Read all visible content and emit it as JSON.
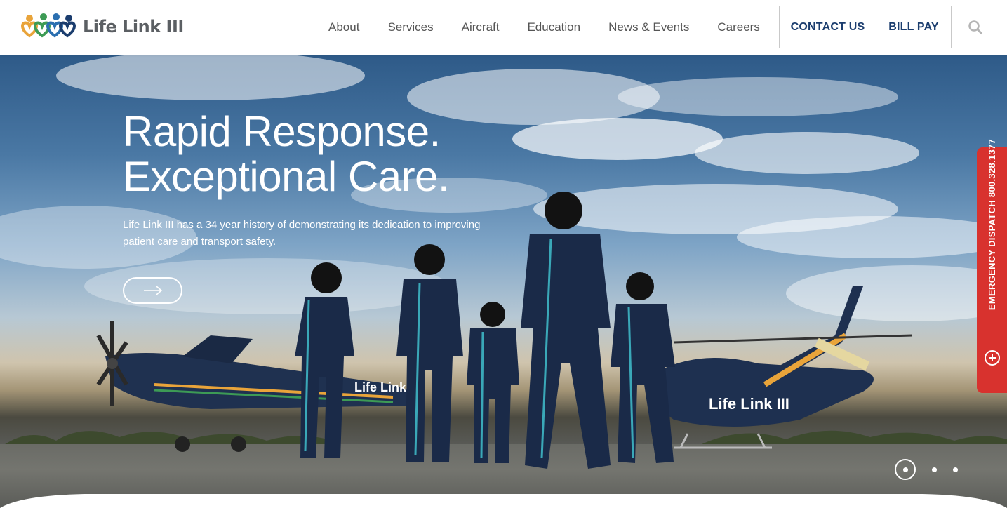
{
  "brand": {
    "name": "Life Link III",
    "colors": {
      "navy": "#1b3d6e",
      "orange": "#e9a43a",
      "green": "#3d9b55",
      "blue": "#2b6fb0",
      "red": "#d8322e"
    }
  },
  "nav": {
    "items": [
      "About",
      "Services",
      "Aircraft",
      "Education",
      "News & Events",
      "Careers"
    ],
    "contact_label": "CONTACT US",
    "billpay_label": "BILL PAY",
    "search_icon": "search-icon"
  },
  "hero": {
    "title_line1": "Rapid Response.",
    "title_line2": "Exceptional Care.",
    "description": "Life Link III has a 34 year history of demonstrating its dedication to improving patient care and transport safety.",
    "cta_icon": "arrow-right-icon",
    "aircraft_labels": {
      "plane": "Life Link",
      "helicopter": "Life Link III"
    },
    "carousel": {
      "slides": 3,
      "active": 1
    }
  },
  "emergency_tab": {
    "label": "EMERGENCY DISPATCH 800.328.1377",
    "icon": "medical-plus-icon"
  }
}
